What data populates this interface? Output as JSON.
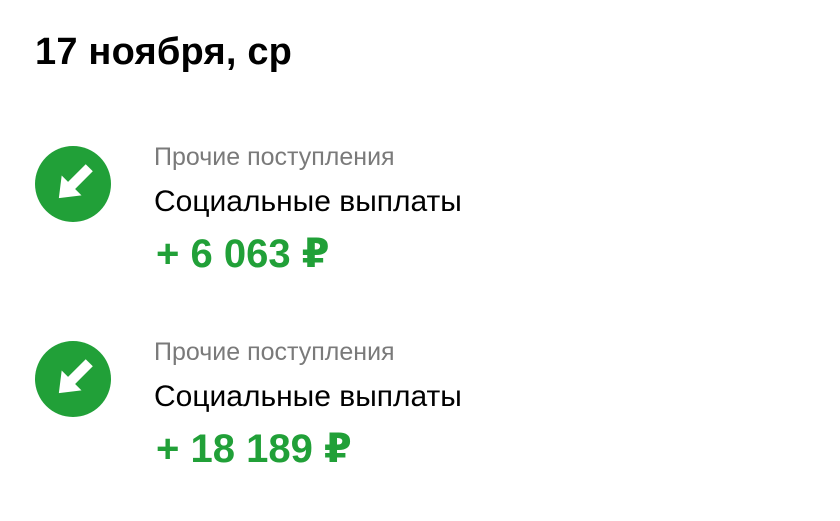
{
  "header": {
    "date": "17 ноября, ср"
  },
  "colors": {
    "accent": "#21a038",
    "category_text": "#7a7a7a"
  },
  "transactions": [
    {
      "icon": "incoming-arrow-icon",
      "category": "Прочие поступления",
      "title": "Социальные выплаты",
      "amount": "+ 6 063 ₽"
    },
    {
      "icon": "incoming-arrow-icon",
      "category": "Прочие поступления",
      "title": "Социальные выплаты",
      "amount": "+ 18 189 ₽"
    }
  ]
}
